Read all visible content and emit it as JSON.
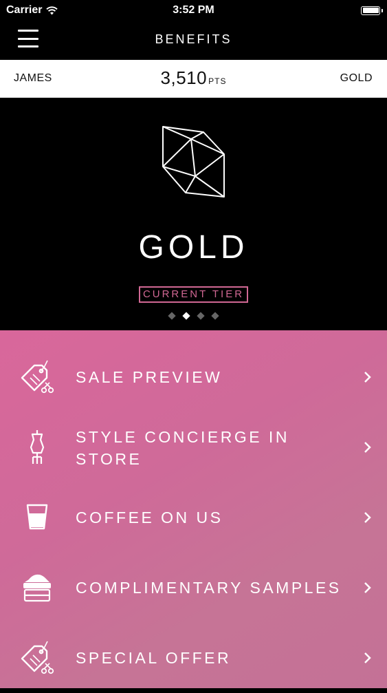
{
  "status_bar": {
    "carrier": "Carrier",
    "time": "3:52 PM"
  },
  "nav": {
    "title": "BENEFITS"
  },
  "member": {
    "name": "JAMES",
    "points": "3,510",
    "points_unit": "PTS",
    "tier": "GOLD"
  },
  "hero": {
    "tier_name": "GOLD",
    "badge": "CURRENT TIER",
    "page_count": 4,
    "active_page": 2
  },
  "benefits": [
    {
      "label": "SALE PREVIEW",
      "icon": "price-tag-scissors-icon"
    },
    {
      "label": "STYLE CONCIERGE IN STORE",
      "icon": "dress-form-icon"
    },
    {
      "label": "COFFEE ON US",
      "icon": "coffee-cup-icon"
    },
    {
      "label": "COMPLIMENTARY SAMPLES",
      "icon": "cream-jar-icon"
    },
    {
      "label": "SPECIAL OFFER",
      "icon": "price-tag-scissors-icon"
    }
  ],
  "colors": {
    "accent_pink": "#d16894",
    "benefits_bg": "#d06a99",
    "header_bg": "#000000",
    "member_bar_bg": "#ffffff"
  }
}
